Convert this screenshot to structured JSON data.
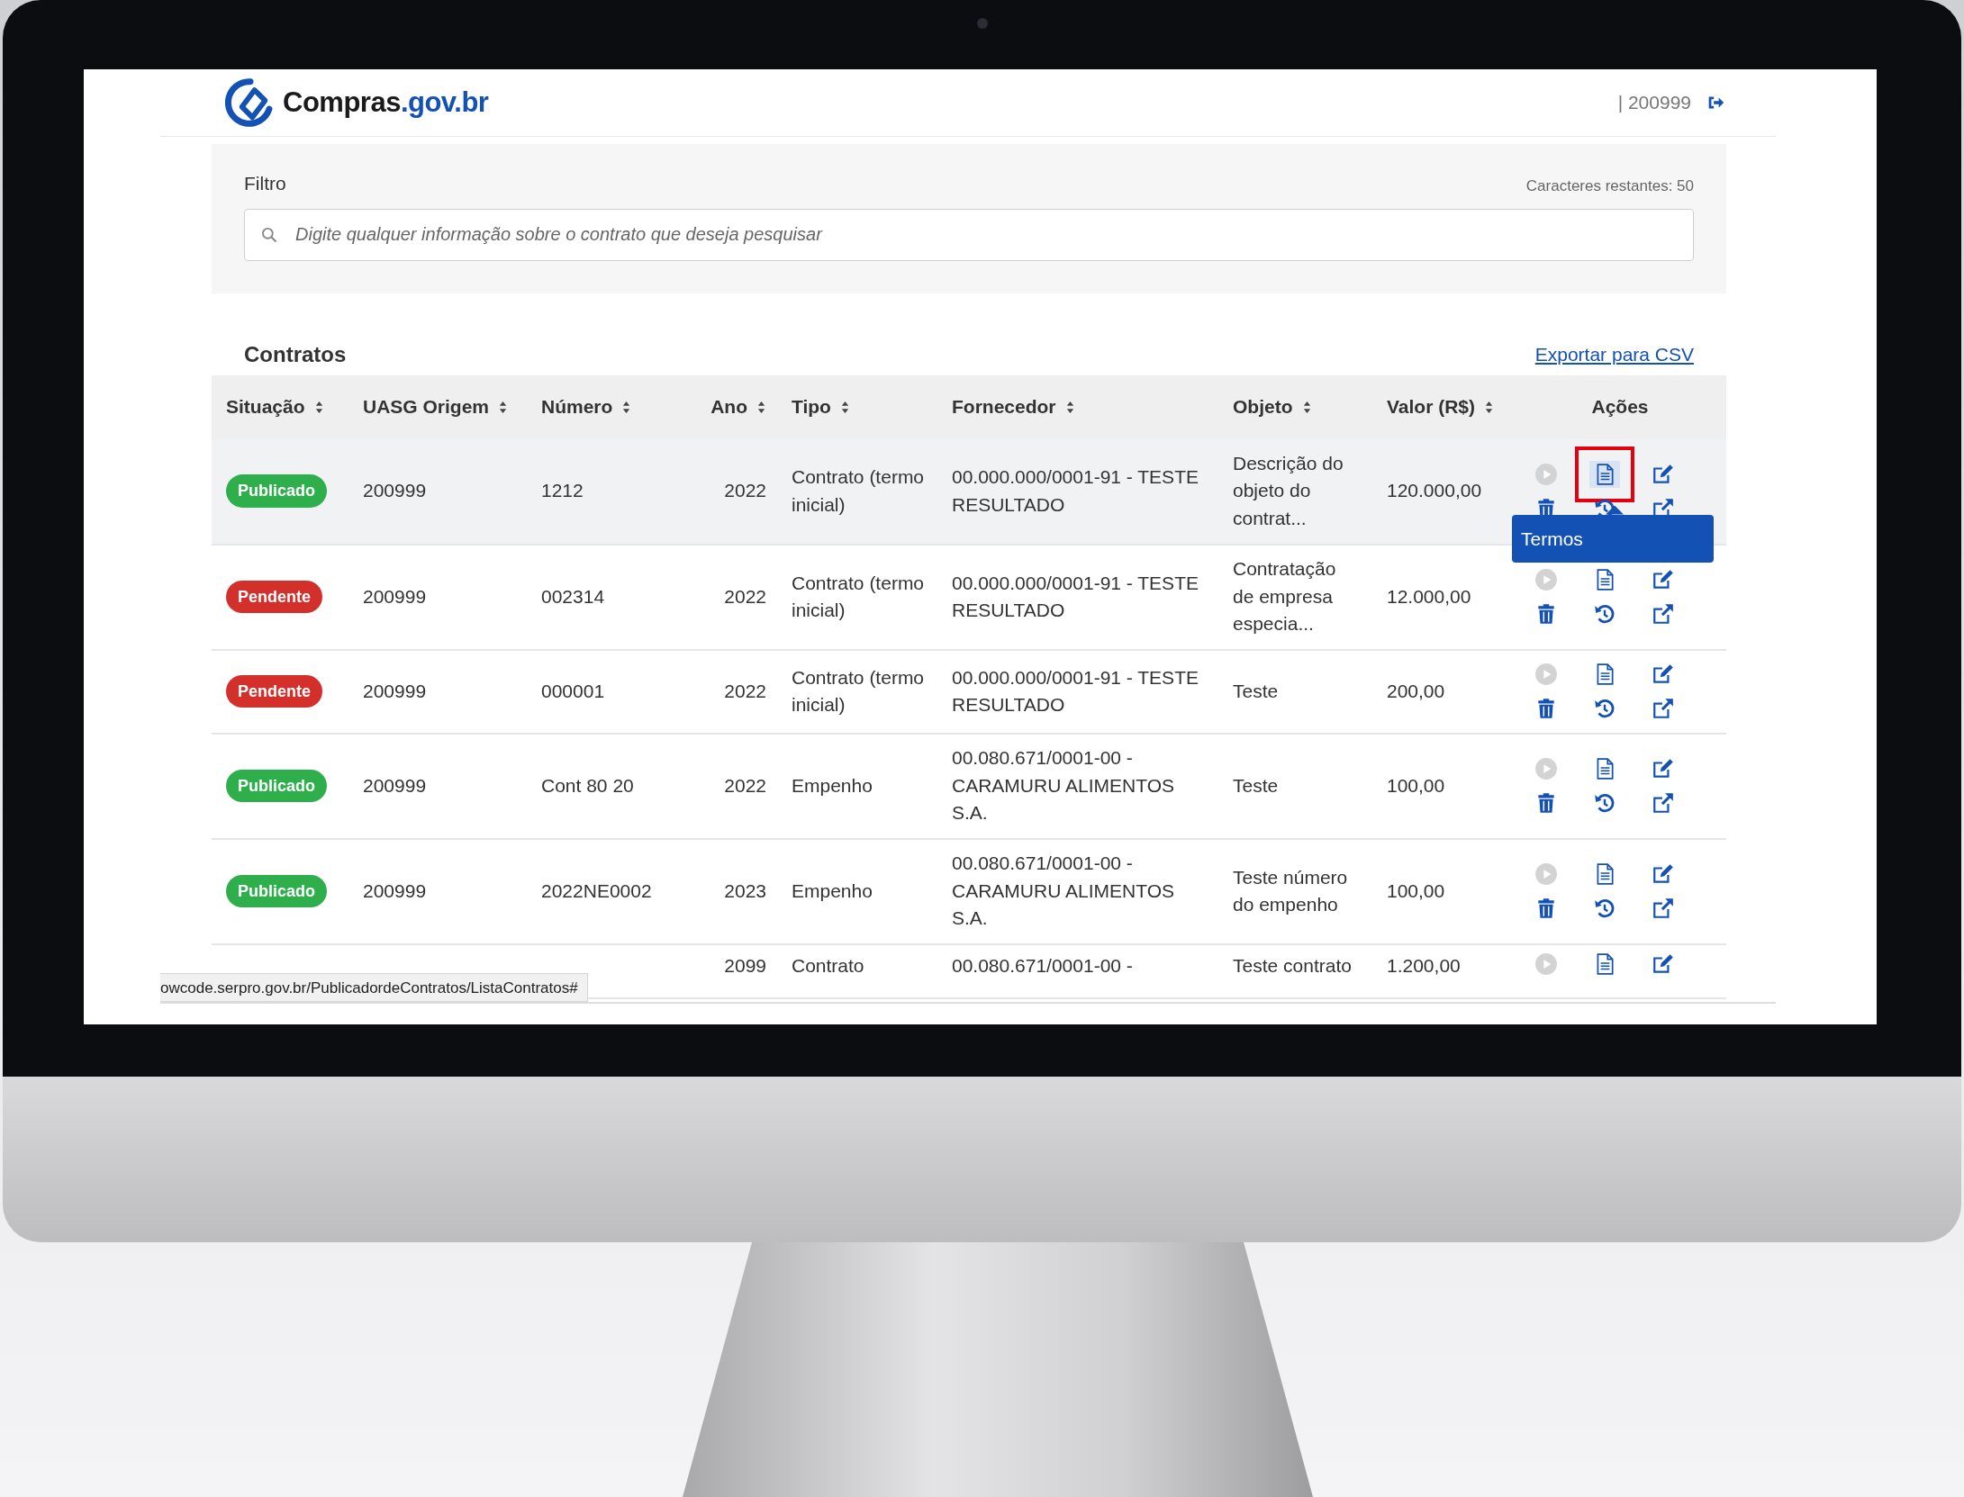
{
  "header": {
    "logo": {
      "name": "Compras",
      "suffix": ".gov.br"
    },
    "user": "| 200999"
  },
  "filter": {
    "label": "Filtro",
    "counter": "Caracteres restantes: 50",
    "placeholder": "Digite qualquer informação sobre o contrato que deseja pesquisar"
  },
  "contracts": {
    "title": "Contratos",
    "export_link": "Exportar para CSV",
    "columns": [
      {
        "label": "Situação",
        "sortable": true
      },
      {
        "label": "UASG Origem",
        "sortable": true
      },
      {
        "label": "Número",
        "sortable": true
      },
      {
        "label": "Ano",
        "sortable": true
      },
      {
        "label": "Tipo",
        "sortable": true
      },
      {
        "label": "Fornecedor",
        "sortable": true
      },
      {
        "label": "Objeto",
        "sortable": true
      },
      {
        "label": "Valor (R$)",
        "sortable": true
      },
      {
        "label": "Ações",
        "sortable": false
      }
    ],
    "rows": [
      {
        "hovered": true,
        "status": {
          "label": "Publicado",
          "kind": "published"
        },
        "uasg": "200999",
        "number": "1212",
        "year": "2022",
        "type": "Contrato (termo inicial)",
        "supplier": "00.000.000/0001-91 - TESTE RESULTADO",
        "object": "Descrição do objeto do contrat...",
        "value": "120.000,00",
        "actions": [
          {
            "kind": "play",
            "disabled": true
          },
          {
            "kind": "document",
            "highlighted": true
          },
          {
            "kind": "edit"
          },
          {
            "kind": "trash"
          },
          {
            "kind": "history"
          },
          {
            "kind": "external-link"
          }
        ]
      },
      {
        "hovered": false,
        "status": {
          "label": "Pendente",
          "kind": "pending"
        },
        "uasg": "200999",
        "number": "002314",
        "year": "2022",
        "type": "Contrato (termo inicial)",
        "supplier": "00.000.000/0001-91 - TESTE RESULTADO",
        "object": "Contratação de empresa especia...",
        "value": "12.000,00",
        "actions": [
          {
            "kind": "play",
            "disabled": true
          },
          {
            "kind": "document",
            "highlighted": false
          },
          {
            "kind": "edit"
          },
          {
            "kind": "trash"
          },
          {
            "kind": "history"
          },
          {
            "kind": "external-link"
          }
        ]
      },
      {
        "hovered": false,
        "status": {
          "label": "Pendente",
          "kind": "pending"
        },
        "uasg": "200999",
        "number": "000001",
        "year": "2022",
        "type": "Contrato (termo inicial)",
        "supplier": "00.000.000/0001-91 - TESTE RESULTADO",
        "object": "Teste",
        "value": "200,00",
        "actions": [
          {
            "kind": "play",
            "disabled": true
          },
          {
            "kind": "document",
            "highlighted": false
          },
          {
            "kind": "edit"
          },
          {
            "kind": "trash"
          },
          {
            "kind": "history"
          },
          {
            "kind": "external-link"
          }
        ]
      },
      {
        "hovered": false,
        "status": {
          "label": "Publicado",
          "kind": "published"
        },
        "uasg": "200999",
        "number": "Cont 80 20",
        "year": "2022",
        "type": "Empenho",
        "supplier": "00.080.671/0001-00 - CARAMURU ALIMENTOS S.A.",
        "object": "Teste",
        "value": "100,00",
        "actions": [
          {
            "kind": "play",
            "disabled": true
          },
          {
            "kind": "document",
            "highlighted": false
          },
          {
            "kind": "edit"
          },
          {
            "kind": "trash"
          },
          {
            "kind": "history"
          },
          {
            "kind": "external-link"
          }
        ]
      },
      {
        "hovered": false,
        "status": {
          "label": "Publicado",
          "kind": "published"
        },
        "uasg": "200999",
        "number": "2022NE0002",
        "year": "2023",
        "type": "Empenho",
        "supplier": "00.080.671/0001-00 - CARAMURU ALIMENTOS S.A.",
        "object": "Teste número do empenho",
        "value": "100,00",
        "actions": [
          {
            "kind": "play",
            "disabled": true
          },
          {
            "kind": "document",
            "highlighted": false
          },
          {
            "kind": "edit"
          },
          {
            "kind": "trash"
          },
          {
            "kind": "history"
          },
          {
            "kind": "external-link"
          }
        ]
      },
      {
        "hovered": false,
        "year": "2099",
        "type": "Contrato",
        "supplier": "00.080.671/0001-00 -",
        "object": "Teste contrato",
        "value": "1.200,00",
        "actions": [
          {
            "kind": "play",
            "disabled": true
          },
          {
            "kind": "document",
            "highlighted": false
          },
          {
            "kind": "edit"
          }
        ]
      }
    ]
  },
  "tooltip": {
    "text": "Termos"
  },
  "status_url": "owcode.serpro.gov.br/PublicadordeContratos/ListaContratos#"
}
